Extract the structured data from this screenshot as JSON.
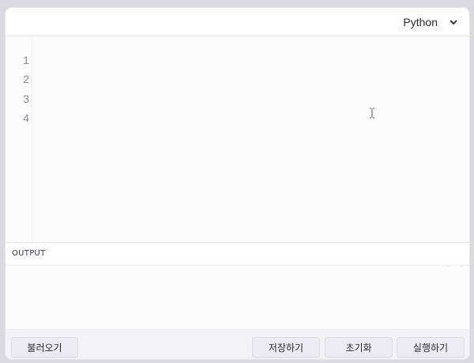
{
  "editor": {
    "language": "Python",
    "line_numbers": [
      "1",
      "2",
      "3",
      "4"
    ]
  },
  "output": {
    "label": "OUTPUT"
  },
  "footer": {
    "load_label": "불러오기",
    "save_label": "저장하기",
    "reset_label": "초기화",
    "run_label": "실행하기"
  },
  "icons": {
    "language_dropdown": "chevron-down-icon",
    "assistant": "assistant-logo-icon",
    "text_cursor": "text-cursor-icon"
  }
}
